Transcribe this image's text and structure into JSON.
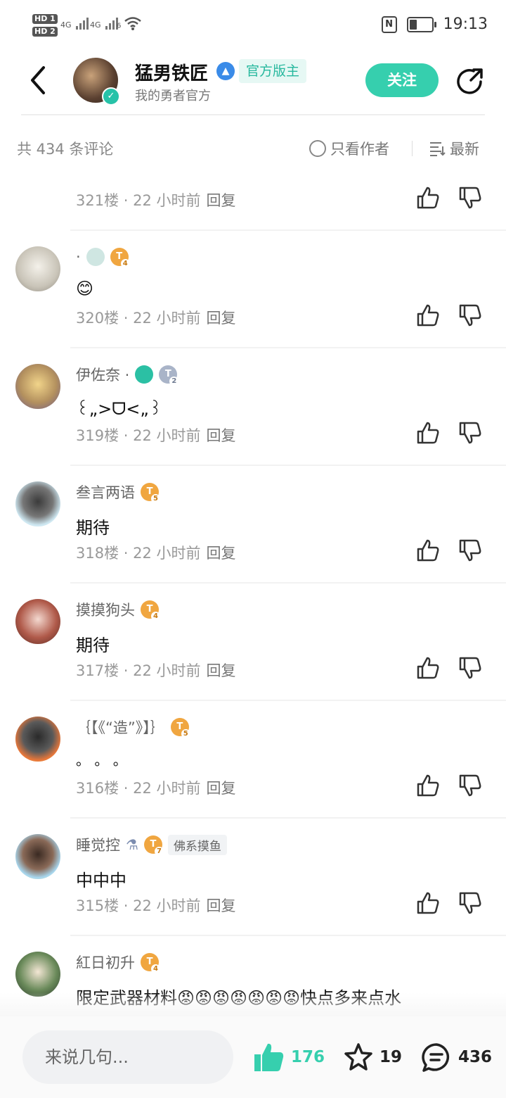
{
  "status_bar": {
    "hd1": "HD 1",
    "hd2": "HD 2",
    "net1": "4G",
    "net2": "4G",
    "wifi_gen": "6",
    "time": "19:13"
  },
  "header": {
    "name": "猛男铁匠",
    "role": "官方版主",
    "subtitle": "我的勇者官方",
    "follow_label": "关注"
  },
  "filter": {
    "count": "共 434 条评论",
    "only_author": "只看作者",
    "sort": "最新"
  },
  "comments": [
    {
      "name": "",
      "level": "",
      "text": "",
      "floor": "321楼",
      "time": "22 小时前",
      "reply": "回复"
    },
    {
      "name": "·",
      "level": "4",
      "text": "😊",
      "floor": "320楼",
      "time": "22 小时前",
      "reply": "回复"
    },
    {
      "name": "伊佐奈 ·",
      "level": "2",
      "text": "꒰„>ᗜ<„꒱",
      "floor": "319楼",
      "time": "22 小时前",
      "reply": "回复"
    },
    {
      "name": "叁言两语",
      "level": "5",
      "text": "期待",
      "floor": "318楼",
      "time": "22 小时前",
      "reply": "回复"
    },
    {
      "name": "摸摸狗头",
      "level": "4",
      "text": "期待",
      "floor": "317楼",
      "time": "22 小时前",
      "reply": "回复"
    },
    {
      "name": "｛【《“造”》】｝",
      "level": "5",
      "text": "。 。 。",
      "floor": "316楼",
      "time": "22 小时前",
      "reply": "回复"
    },
    {
      "name": "睡觉控",
      "level": "7",
      "tag": "佛系摸鱼",
      "text": "中中中",
      "floor": "315楼",
      "time": "22 小时前",
      "reply": "回复"
    },
    {
      "name": "紅日初升",
      "level": "4",
      "text": "限定武器材料😡😡😡😡😡😡😡快点多来点水",
      "floor": "",
      "time": "",
      "reply": ""
    }
  ],
  "bottom": {
    "input_placeholder": "来说几句...",
    "likes": "176",
    "favorites": "19",
    "comments": "436"
  },
  "colors": {
    "accent": "#36cfae",
    "level_gold": "#f0a640",
    "level_silver": "#a9b4c8"
  }
}
